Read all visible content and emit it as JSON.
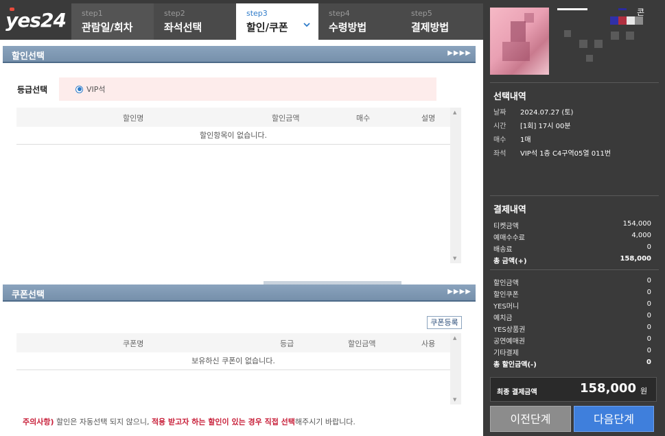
{
  "brand": {
    "logo_text": "yes24"
  },
  "steps": [
    {
      "num": "step1",
      "title": "관람일/회차"
    },
    {
      "num": "step2",
      "title": "좌석선택"
    },
    {
      "num": "step3",
      "title": "할인/쿠폰"
    },
    {
      "num": "step4",
      "title": "수령방법"
    },
    {
      "num": "step5",
      "title": "결제방법"
    }
  ],
  "discount_section": {
    "title": "할인선택",
    "arrows": "▶▶▶▶",
    "grade_label": "등급선택",
    "grade_option": "VIP석",
    "table": {
      "headers": [
        "할인명",
        "할인금액",
        "매수",
        "설명"
      ],
      "empty_text": "할인항목이 없습니다."
    }
  },
  "coupon_section": {
    "title": "쿠폰선택",
    "arrows": "▶▶▶▶",
    "register_button": "쿠폰등록",
    "table": {
      "headers": [
        "쿠폰명",
        "등급",
        "할인금액",
        "사용"
      ],
      "empty_text": "보유하신 쿠폰이 없습니다."
    }
  },
  "notice": {
    "prefix": "주의사항)",
    "text1": " 할인은 자동선택 되지 않으니, ",
    "emphasis": "적용 받고자 하는 할인이 있는 경우 직접 선택",
    "text2": "해주시기 바랍니다."
  },
  "panel": {
    "show_title_fragment": "콘",
    "selection": {
      "title": "선택내역",
      "rows": [
        {
          "k": "날짜",
          "v": "2024.07.27 (토)"
        },
        {
          "k": "시간",
          "v": "[1회] 17시 00분"
        },
        {
          "k": "매수",
          "v": "1매"
        },
        {
          "k": "좌석",
          "v": "VIP석 1층 C4구역05열 011번"
        }
      ]
    },
    "payment": {
      "title": "결제내역",
      "rows": [
        {
          "k": "티켓금액",
          "v": "154,000"
        },
        {
          "k": "예매수수료",
          "v": "4,000"
        },
        {
          "k": "배송료",
          "v": "0"
        },
        {
          "k": "총 금액(+)",
          "v": "158,000"
        }
      ],
      "discount_rows": [
        {
          "k": "할인금액",
          "v": "0"
        },
        {
          "k": "할인쿠폰",
          "v": "0"
        },
        {
          "k": "YES머니",
          "v": "0"
        },
        {
          "k": "예치금",
          "v": "0"
        },
        {
          "k": "YES상품권",
          "v": "0"
        },
        {
          "k": "공연예매권",
          "v": "0"
        },
        {
          "k": "기타결제",
          "v": "0"
        },
        {
          "k": "총 할인금액(-)",
          "v": "0"
        }
      ]
    },
    "final": {
      "label": "최종 결제금액",
      "amount": "158,000",
      "unit": "원"
    },
    "prev_button": "이전단계",
    "next_button": "다음단계"
  }
}
